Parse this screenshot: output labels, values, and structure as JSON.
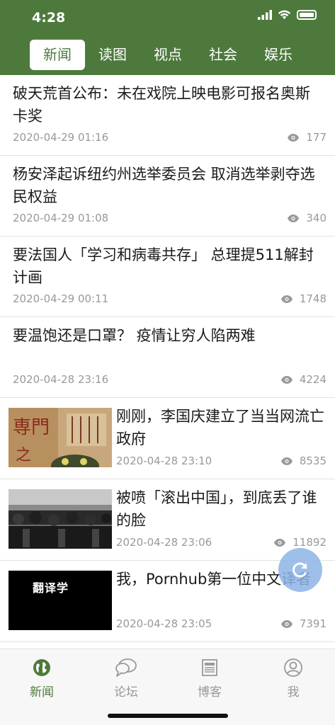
{
  "status_bar": {
    "time": "4:28"
  },
  "tabs": [
    {
      "label": "新闻",
      "active": true
    },
    {
      "label": "读图",
      "active": false
    },
    {
      "label": "视点",
      "active": false
    },
    {
      "label": "社会",
      "active": false
    },
    {
      "label": "娱乐",
      "active": false
    }
  ],
  "articles": [
    {
      "title": "破天荒首公布：未在戏院上映电影可报名奥斯卡奖",
      "date": "2020-04-29 01:16",
      "views": "177"
    },
    {
      "title": "杨安泽起诉纽约州选举委员会 取消选举剥夺选民权益",
      "date": "2020-04-29 01:08",
      "views": "340"
    },
    {
      "title": "要法国人「学习和病毒共存」 总理提511解封计画",
      "date": "2020-04-29 00:11",
      "views": "1748"
    },
    {
      "title": "要温饱还是口罩？ 疫情让穷人陷两难",
      "date": "2020-04-28 23:16",
      "views": "4224"
    },
    {
      "title": "刚刚，李国庆建立了当当网流亡政府",
      "date": "2020-04-28 23:10",
      "views": "8535",
      "thumb": "book-cover"
    },
    {
      "title": "被喷「滚出中国」，到底丢了谁的脸",
      "date": "2020-04-28 23:06",
      "views": "11892",
      "thumb": "crowd-photo"
    },
    {
      "title": "我，Pornhub第一位中文译者",
      "date": "2020-04-28 23:05",
      "views": "7391",
      "thumb": "translator-logo",
      "thumb_text": "翻译学"
    }
  ],
  "bottom_tabs": [
    {
      "label": "新闻",
      "icon": "globe-icon",
      "active": true
    },
    {
      "label": "论坛",
      "icon": "chat-bubbles-icon",
      "active": false
    },
    {
      "label": "博客",
      "icon": "newspaper-icon",
      "active": false
    },
    {
      "label": "我",
      "icon": "person-icon",
      "active": false
    }
  ],
  "colors": {
    "brand": "#4d7a3c",
    "muted": "#999999"
  }
}
